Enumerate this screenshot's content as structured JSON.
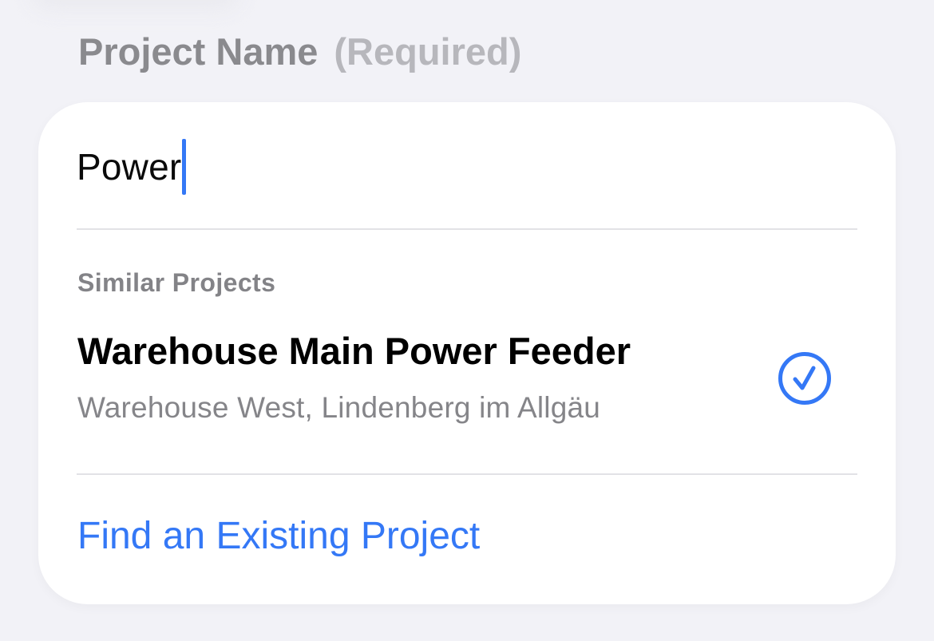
{
  "section": {
    "title": "Project Name",
    "required_label": "(Required)"
  },
  "name_input": {
    "value": "Power"
  },
  "similar": {
    "label": "Similar Projects",
    "items": [
      {
        "title": "Warehouse Main Power Feeder",
        "subtitle": "Warehouse West, Lindenberg im Allgäu",
        "selected": true,
        "icon": "checkmark-circle-icon"
      }
    ]
  },
  "find_link": {
    "label": "Find an Existing Project"
  },
  "colors": {
    "background": "#f2f2f7",
    "card": "#ffffff",
    "accent": "#3478f6",
    "secondary_text": "#8a8a8e",
    "divider": "#e2e2e6"
  }
}
